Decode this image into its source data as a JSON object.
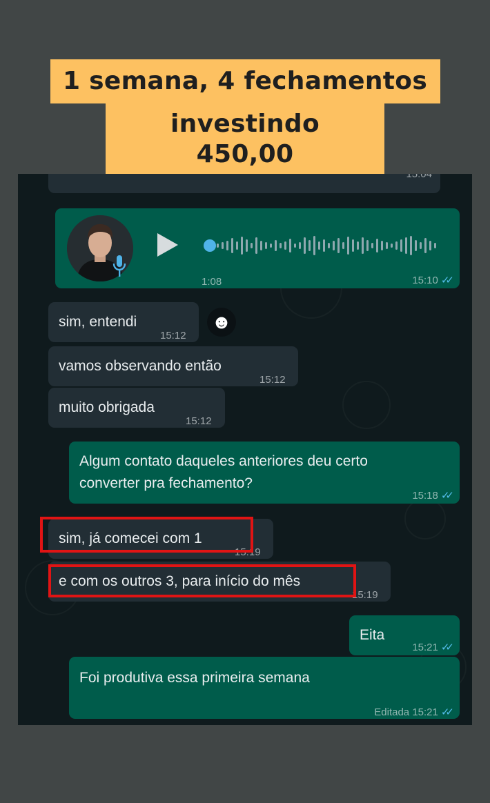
{
  "headline": {
    "line1": "1 semana, 4 fechamentos",
    "line2": "investindo 450,00"
  },
  "chat": {
    "top_partial_time": "15:04",
    "voice_message": {
      "duration": "1:08",
      "time": "15:10",
      "progress": 0.0
    },
    "reaction_emoji": "☻",
    "messages": [
      {
        "dir": "in",
        "text": "sim, entendi",
        "time": "15:12"
      },
      {
        "dir": "in",
        "text": "vamos observando então",
        "time": "15:12"
      },
      {
        "dir": "in",
        "text": "muito obrigada",
        "time": "15:12"
      },
      {
        "dir": "out",
        "text_line1": "Algum contato daqueles anteriores deu certo",
        "text_line2": "converter pra fechamento?",
        "time": "15:18"
      },
      {
        "dir": "in",
        "text": "sim, já comecei com 1",
        "time": "15:19"
      },
      {
        "dir": "in",
        "text": "e com os outros 3, para início do mês",
        "time": "15:19"
      },
      {
        "dir": "out",
        "text": "Eita",
        "time": "15:21"
      },
      {
        "dir": "out",
        "text": "Foi produtiva essa primeira semana",
        "edited": "Editada",
        "time": "15:21"
      }
    ],
    "ticks": "✓✓",
    "colors": {
      "background": "#0f1a1d",
      "incoming": "#222e35",
      "outgoing": "#005c4b",
      "highlight": "#e01414",
      "read_ticks": "#53bdeb",
      "headline_bg": "#fdc161"
    }
  }
}
